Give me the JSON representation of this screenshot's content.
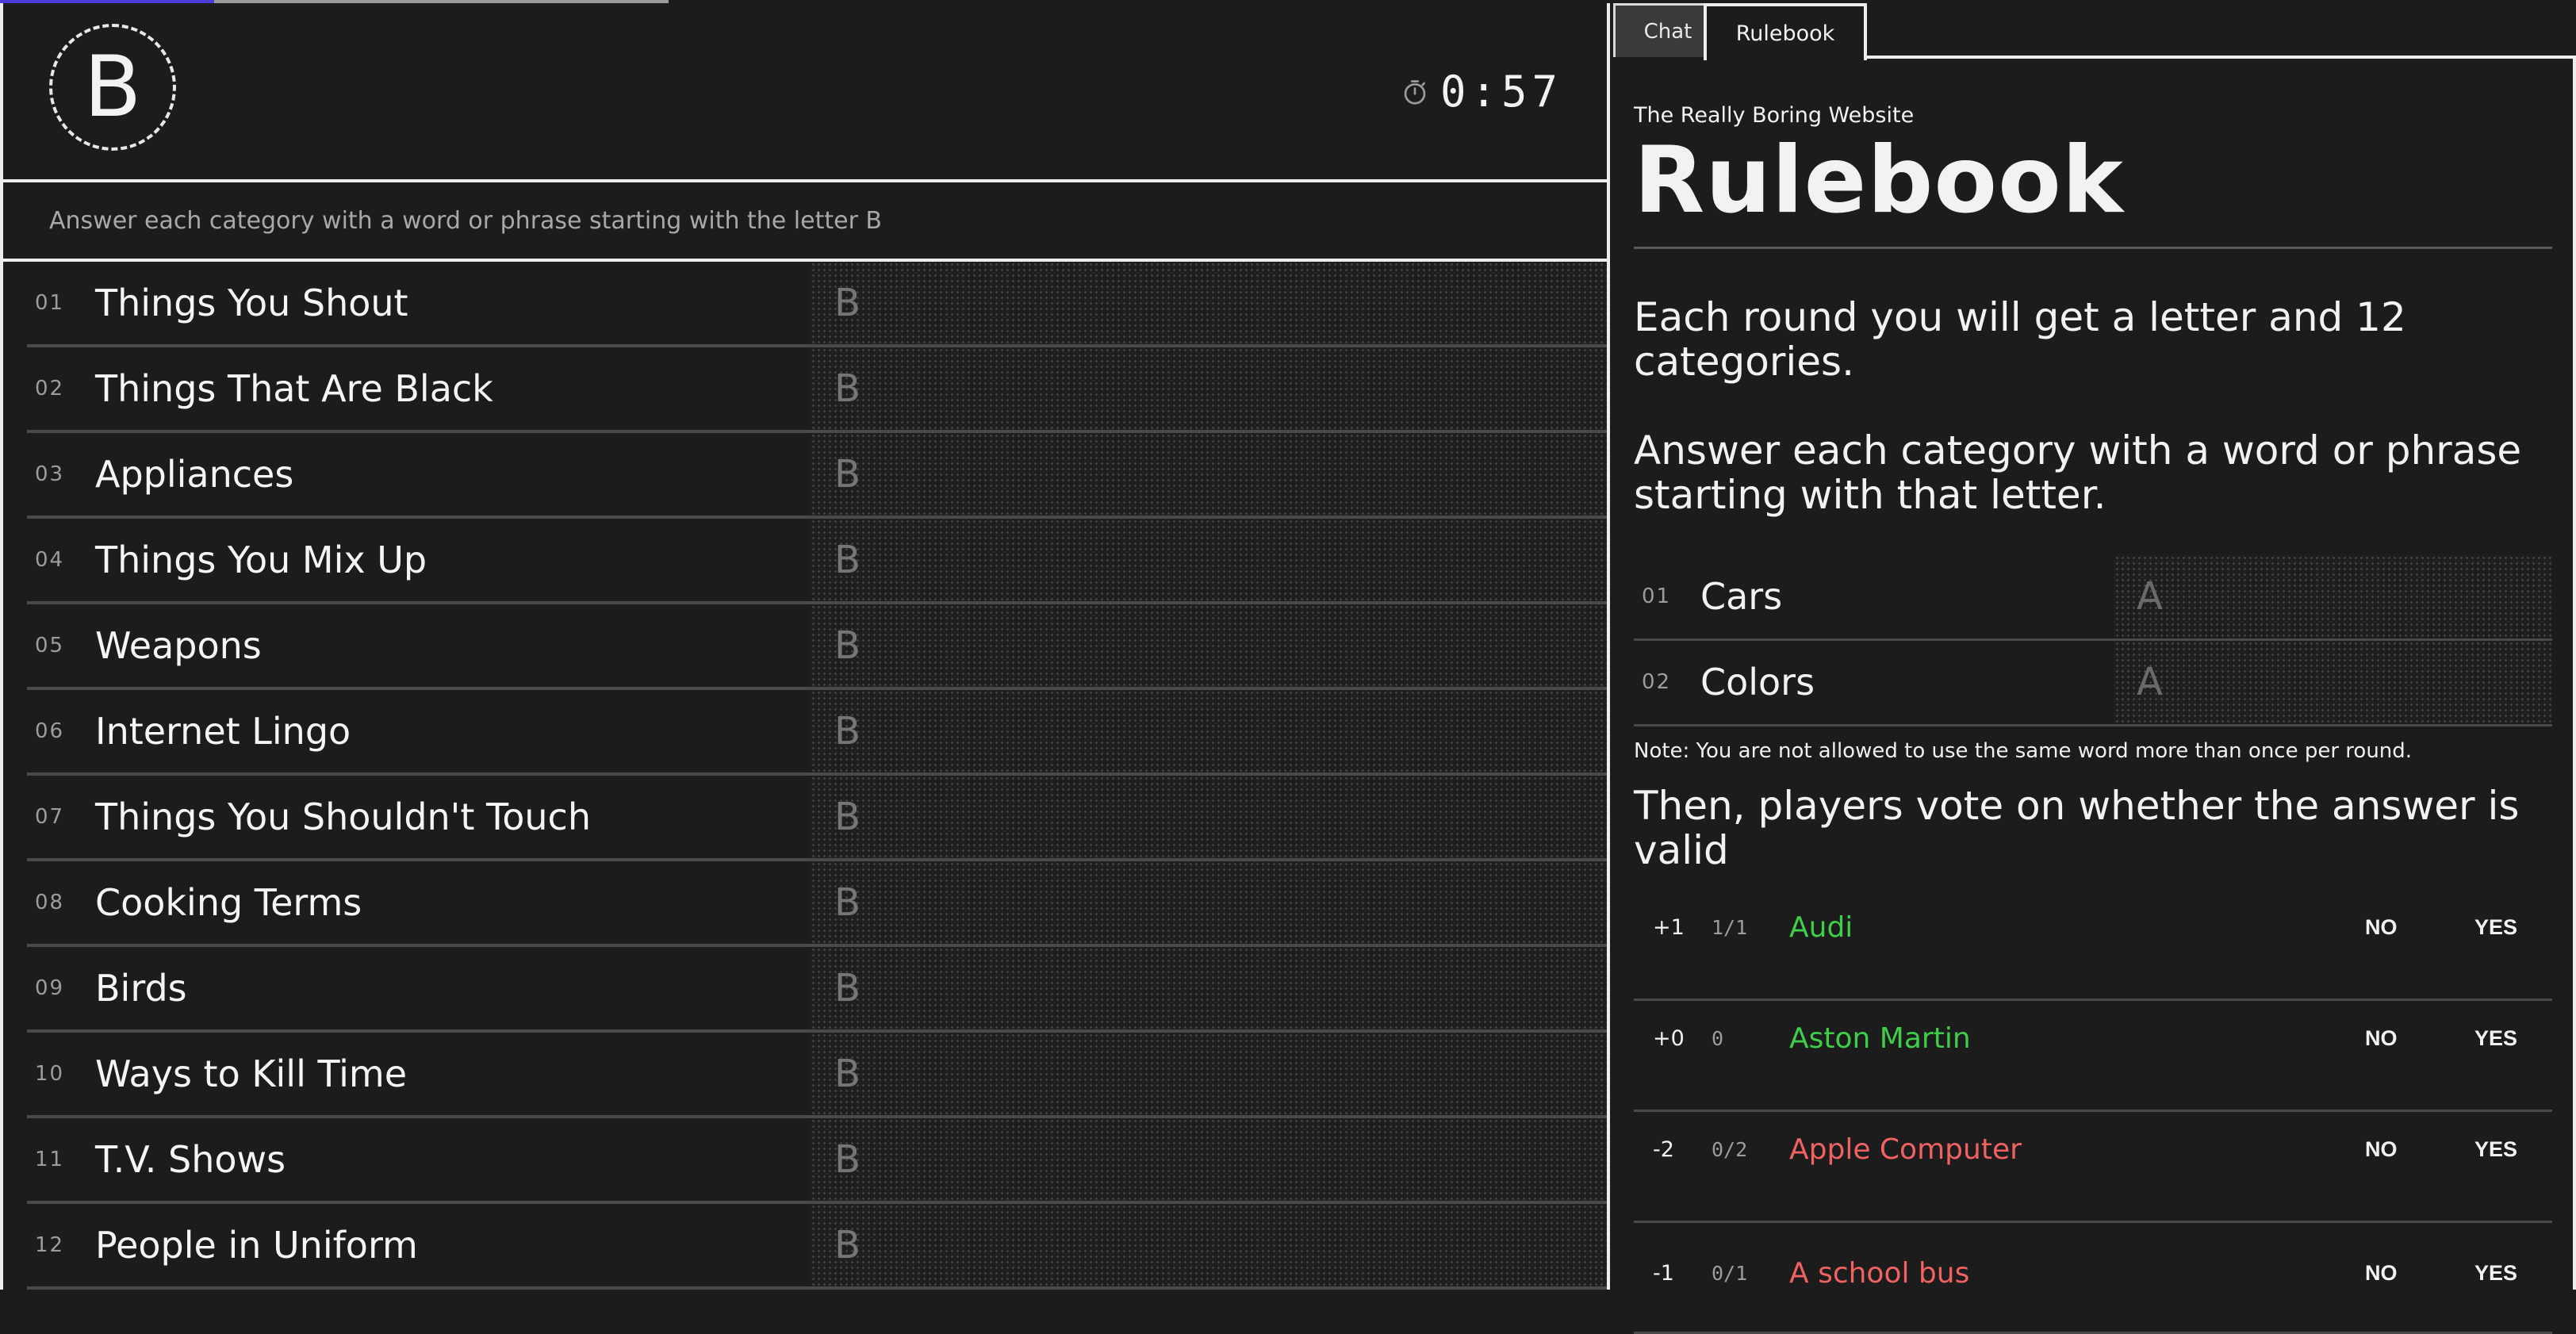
{
  "game": {
    "letter": "B",
    "timer": "0:57",
    "instructions": "Answer each category with a word or phrase starting with the letter B",
    "categories": [
      {
        "num": "01",
        "label": "Things You Shout",
        "placeholder": "B"
      },
      {
        "num": "02",
        "label": "Things That Are Black",
        "placeholder": "B"
      },
      {
        "num": "03",
        "label": "Appliances",
        "placeholder": "B"
      },
      {
        "num": "04",
        "label": "Things You Mix Up",
        "placeholder": "B"
      },
      {
        "num": "05",
        "label": "Weapons",
        "placeholder": "B"
      },
      {
        "num": "06",
        "label": "Internet Lingo",
        "placeholder": "B"
      },
      {
        "num": "07",
        "label": "Things You Shouldn't Touch",
        "placeholder": "B"
      },
      {
        "num": "08",
        "label": "Cooking Terms",
        "placeholder": "B"
      },
      {
        "num": "09",
        "label": "Birds",
        "placeholder": "B"
      },
      {
        "num": "10",
        "label": "Ways to Kill Time",
        "placeholder": "B"
      },
      {
        "num": "11",
        "label": "T.V. Shows",
        "placeholder": "B"
      },
      {
        "num": "12",
        "label": "People in Uniform",
        "placeholder": "B"
      }
    ]
  },
  "tabs": {
    "chat": "Chat",
    "rulebook": "Rulebook",
    "active": "Rulebook"
  },
  "rulebook": {
    "site_name": "The Really Boring Website",
    "title": "Rulebook",
    "para1": "Each round you will get a letter and 12 categories.",
    "para2": "Answer each category with a word or phrase starting with that letter.",
    "examples": [
      {
        "num": "01",
        "label": "Cars",
        "answer": "A"
      },
      {
        "num": "02",
        "label": "Colors",
        "answer": "A"
      }
    ],
    "note": "Note: You are not allowed to use the same word more than once per round.",
    "para3": "Then, players vote on whether the answer is valid",
    "votes": [
      {
        "score": "+1",
        "count": "1/1",
        "answer": "Audi",
        "status": "valid",
        "no": "NO",
        "yes": "YES"
      },
      {
        "score": "+0",
        "count": "0",
        "answer": "Aston Martin",
        "status": "valid",
        "no": "NO",
        "yes": "YES"
      },
      {
        "score": "-2",
        "count": "0/2",
        "answer": "Apple Computer",
        "status": "invalid",
        "no": "NO",
        "yes": "YES"
      },
      {
        "score": "-1",
        "count": "0/1",
        "answer": "A school bus",
        "status": "invalid",
        "no": "NO",
        "yes": "YES"
      }
    ]
  },
  "colors": {
    "valid": "#3ecf4a",
    "invalid": "#f06262",
    "accent": "#4a3cd8",
    "background": "#1c1c1c"
  },
  "icons": {
    "timer": "stopwatch-icon"
  }
}
